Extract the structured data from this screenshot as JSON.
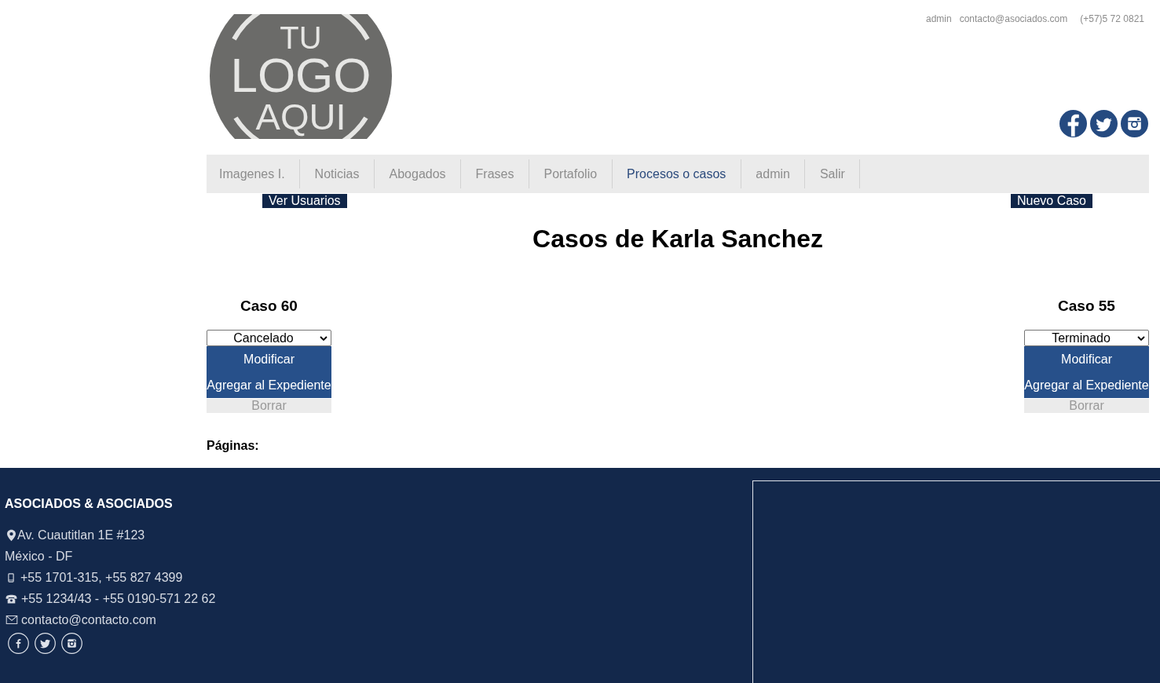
{
  "top_bar": {
    "user": "admin",
    "email": "contacto@asociados.com",
    "phone": "(+57)5 72 0821"
  },
  "logo": {
    "lines": [
      "TU",
      "LOGO",
      "AQUI"
    ]
  },
  "nav": {
    "items": [
      {
        "label": "Imagenes I.",
        "selected": false
      },
      {
        "label": "Noticias",
        "selected": false
      },
      {
        "label": "Abogados",
        "selected": false
      },
      {
        "label": "Frases",
        "selected": false
      },
      {
        "label": "Portafolio",
        "selected": false
      },
      {
        "label": "Procesos o casos",
        "selected": true
      },
      {
        "label": "admin",
        "selected": false
      },
      {
        "label": "Salir",
        "selected": false
      }
    ]
  },
  "toolbar": {
    "left_button": "Ver Usuarios",
    "right_button": "Nuevo Caso"
  },
  "page_title": "Casos de Karla Sanchez",
  "cases": [
    {
      "title": "Caso 60",
      "status": "Cancelado",
      "actions": [
        {
          "label": "Modificar",
          "kind": "primary"
        },
        {
          "label": "Agregar al Expediente",
          "kind": "primary"
        },
        {
          "label": "Borrar",
          "kind": "secondary"
        }
      ]
    },
    {
      "title": "Caso 55",
      "status": "Terminado",
      "actions": [
        {
          "label": "Modificar",
          "kind": "primary"
        },
        {
          "label": "Agregar al Expediente",
          "kind": "primary"
        },
        {
          "label": "Borrar",
          "kind": "secondary"
        }
      ]
    }
  ],
  "pagination": {
    "label": "Páginas:"
  },
  "footer": {
    "company": "ASOCIADOS & ASOCIADOS",
    "contacts": [
      {
        "kind": "address",
        "text": "Av. Cuautitlan 1E #123"
      },
      {
        "kind": "plain",
        "text": "México - DF"
      },
      {
        "kind": "mobile",
        "text": "+55 1701-315, +55 827 4399"
      },
      {
        "kind": "phone",
        "text": "+55 1234/43 - +55 0190-571 22 62"
      },
      {
        "kind": "email",
        "text": "contacto@contacto.com"
      }
    ]
  }
}
